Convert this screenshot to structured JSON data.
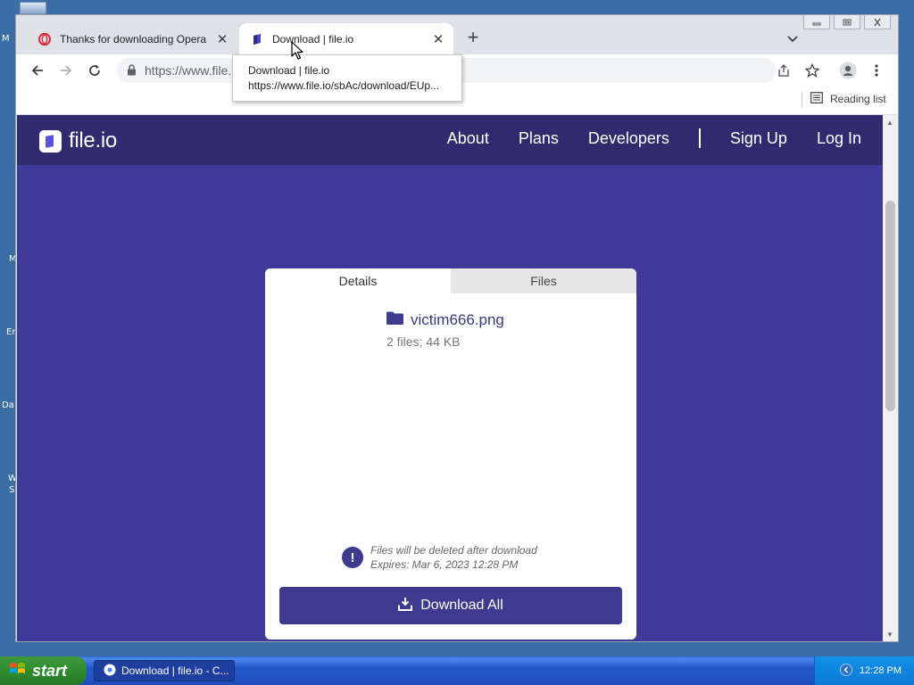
{
  "browser": {
    "tabs": [
      {
        "title": "Thanks for downloading Opera",
        "active": false
      },
      {
        "title": "Download | file.io",
        "active": true
      }
    ],
    "address": {
      "url": "https://www.file."
    },
    "tooltip": {
      "title": "Download | file.io",
      "url": "https://www.file.io/sbAc/download/EUp..."
    },
    "bookmarks": {
      "reading_list": "Reading list"
    }
  },
  "site": {
    "logo": "file.io",
    "nav": [
      "About",
      "Plans",
      "Developers",
      "Sign Up",
      "Log In"
    ],
    "card": {
      "tabs": [
        "Details",
        "Files"
      ],
      "file_name": "victim666.png",
      "file_meta": "2 files; 44 KB",
      "notice_line1": "Files will be deleted after download",
      "notice_line2": "Expires: Mar 6, 2023 12:28 PM",
      "download_label": "Download All"
    }
  },
  "taskbar": {
    "start_label": "start",
    "window_item": "Download | file.io - C...",
    "clock": "12:28 PM"
  },
  "desktop": {
    "labels": [
      "M",
      "M",
      "Er",
      "Da",
      "W",
      "S"
    ]
  }
}
